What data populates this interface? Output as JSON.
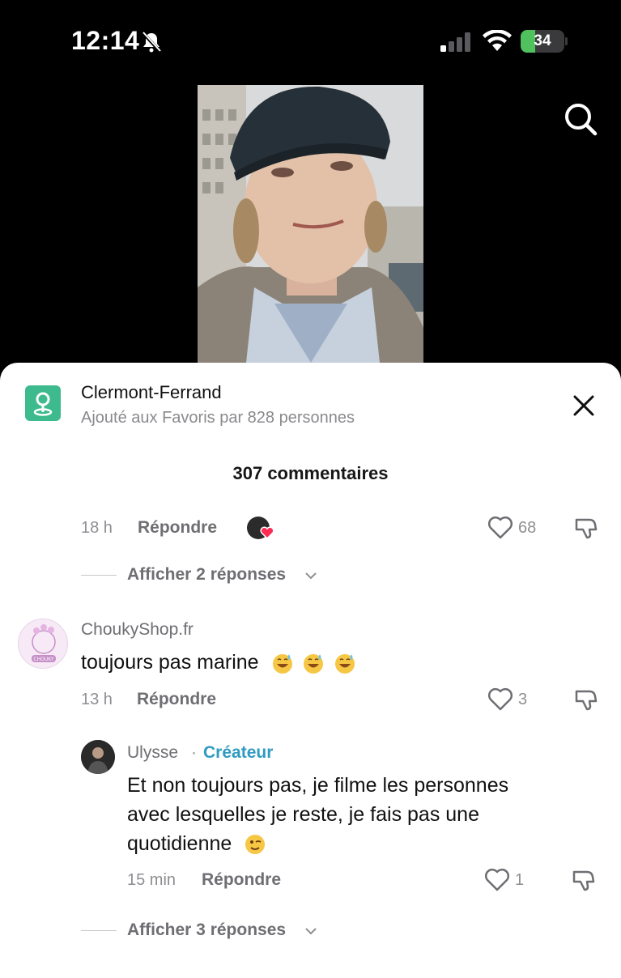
{
  "status_bar": {
    "time": "12:14",
    "battery": "34",
    "battery_percent": 34
  },
  "place": {
    "name": "Clermont-Ferrand",
    "subtitle": "Ajouté aux Favoris par 828 personnes"
  },
  "comments_header": "307 commentaires",
  "comments": [
    {
      "time": "18 h",
      "reply_label": "Répondre",
      "likes": "68",
      "show_replies": "Afficher 2 réponses"
    },
    {
      "username": "ChoukyShop.fr",
      "avatar_text": "CHOUKY",
      "text": "toujours pas marine",
      "time": "13 h",
      "reply_label": "Répondre",
      "likes": "3",
      "reply": {
        "username": "Ulysse",
        "separator": "·",
        "creator_label": "Créateur",
        "text_lines": [
          "Et non toujours pas, je filme les personnes",
          "avec lesquelles je reste, je fais pas une",
          "quotidienne"
        ],
        "time": "15 min",
        "reply_label": "Répondre",
        "likes": "1"
      },
      "show_replies": "Afficher 3 réponses"
    }
  ],
  "colors": {
    "accent_creator": "#2f9bc1",
    "place_icon": "#3dba8e",
    "battery_fill": "#4fc25e",
    "like_heart": "#fe2c55"
  }
}
